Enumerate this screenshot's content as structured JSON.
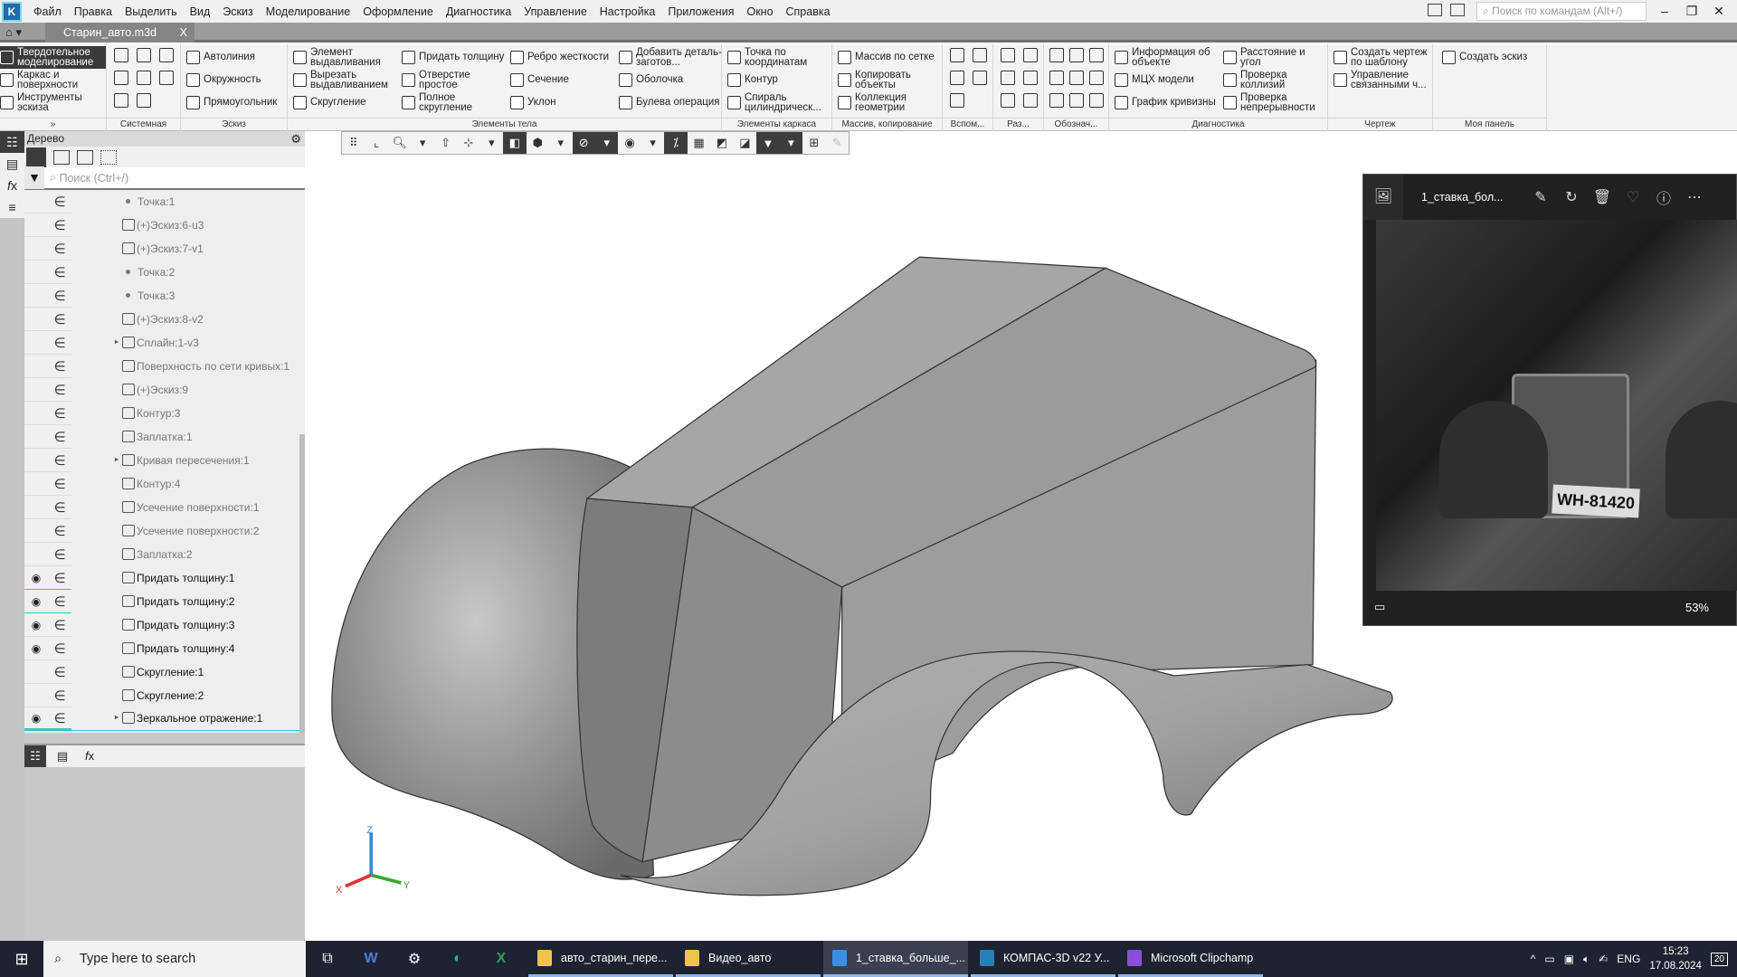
{
  "menubar": {
    "items": [
      "Файл",
      "Правка",
      "Выделить",
      "Вид",
      "Эскиз",
      "Моделирование",
      "Оформление",
      "Диагностика",
      "Управление",
      "Настройка",
      "Приложения",
      "Окно",
      "Справка"
    ],
    "search_placeholder": "Поиск по командам (Alt+/)"
  },
  "tab": {
    "title": "Старин_авто.m3d",
    "close": "X"
  },
  "ribbon": {
    "modes": [
      "Твердотельное моделирование",
      "Каркас и поверхности",
      "Инструменты эскиза"
    ],
    "modes_label": "»",
    "system_label": "Системная",
    "sketch": {
      "label": "Эскиз",
      "items": [
        "Автолиния",
        "Окружность",
        "Прямоугольник"
      ]
    },
    "body": {
      "label": "Элементы тела",
      "columns": [
        [
          "Элемент выдавливания",
          "Вырезать выдавливанием",
          "Скругление"
        ],
        [
          "Придать толщину",
          "Отверстие простое",
          "Полное скругление"
        ],
        [
          "Ребро жесткости",
          "Сечение",
          "Уклон"
        ],
        [
          "Добавить деталь-заготов...",
          "Оболочка",
          "Булева операция"
        ]
      ]
    },
    "wire": {
      "label": "Элементы каркаса",
      "items": [
        "Точка по координатам",
        "Контур",
        "Спираль цилиндрическ..."
      ]
    },
    "array": {
      "label": "Массив, копирование",
      "items": [
        "Массив по сетке",
        "Копировать объекты",
        "Коллекция геометрии"
      ]
    },
    "aux_label": "Вспом...",
    "sec_label": "Раз...",
    "mark_label": "Обознач...",
    "diag": {
      "label": "Диагностика",
      "columns": [
        [
          "Информация об объекте",
          "МЦХ модели",
          "График кривизны"
        ],
        [
          "Расстояние и угол",
          "Проверка коллизий",
          "Проверка непрерывности"
        ]
      ]
    },
    "drawing": {
      "label": "Чертеж",
      "items": [
        "Создать чертеж по шаблону",
        "Управление связанными ч..."
      ]
    },
    "mypanel": {
      "label": "Моя панель",
      "items": [
        "Создать эскиз"
      ]
    }
  },
  "tree": {
    "title": "Дерево",
    "search_placeholder": "Поиск (Ctrl+/)",
    "rows": [
      {
        "label": "Точка:1",
        "icon": "point",
        "visible": false
      },
      {
        "label": "(+)Эскиз:6-u3",
        "icon": "sketch",
        "visible": false
      },
      {
        "label": "(+)Эскиз:7-v1",
        "icon": "sketch",
        "visible": false
      },
      {
        "label": "Точка:2",
        "icon": "point",
        "visible": false
      },
      {
        "label": "Точка:3",
        "icon": "point",
        "visible": false
      },
      {
        "label": "(+)Эскиз:8-v2",
        "icon": "sketch",
        "visible": false
      },
      {
        "label": "Сплайн:1-v3",
        "icon": "spline",
        "visible": false,
        "expandable": true
      },
      {
        "label": "Поверхность по сети кривых:1",
        "icon": "surface",
        "visible": false
      },
      {
        "label": "(+)Эскиз:9",
        "icon": "sketch",
        "visible": false
      },
      {
        "label": "Контур:3",
        "icon": "contour",
        "visible": false
      },
      {
        "label": "Заплатка:1",
        "icon": "patch",
        "visible": false
      },
      {
        "label": "Кривая пересечения:1",
        "icon": "curve",
        "visible": false,
        "expandable": true
      },
      {
        "label": "Контур:4",
        "icon": "contour",
        "visible": false
      },
      {
        "label": "Усечение поверхности:1",
        "icon": "trim",
        "visible": false
      },
      {
        "label": "Усечение поверхности:2",
        "icon": "trim",
        "visible": false
      },
      {
        "label": "Заплатка:2",
        "icon": "patch",
        "visible": false
      },
      {
        "label": "Придать толщину:1",
        "icon": "thicken",
        "visible": true,
        "highlight": true
      },
      {
        "label": "Придать толщину:2",
        "icon": "thicken",
        "visible": true,
        "highlight": true
      },
      {
        "label": "Придать толщину:3",
        "icon": "thicken",
        "visible": true
      },
      {
        "label": "Придать толщину:4",
        "icon": "thicken",
        "visible": true
      },
      {
        "label": "Скругление:1",
        "icon": "fillet",
        "visible": false,
        "dark": true
      },
      {
        "label": "Скругление:2",
        "icon": "fillet",
        "visible": false,
        "dark": true
      },
      {
        "label": "Зеркальное отражение:1",
        "icon": "mirror",
        "visible": true,
        "expandable": true,
        "selected": true
      }
    ]
  },
  "triad": {
    "x": "X",
    "y": "Y",
    "z": "Z"
  },
  "viewer": {
    "title": "1_ставка_бол...",
    "zoom": "53%",
    "plate": "WH-81420"
  },
  "taskbar": {
    "search_placeholder": "Type here to search",
    "apps": [
      {
        "label": "авто_старин_пере...",
        "color": "#f2c14e",
        "active": false
      },
      {
        "label": "Видео_авто",
        "color": "#f2c14e",
        "active": false
      },
      {
        "label": "1_ставка_больше_...",
        "color": "#3b8fe0",
        "active": true
      },
      {
        "label": "КОМПАС-3D v22 У...",
        "color": "#2a7fb8",
        "active": false
      },
      {
        "label": "Microsoft Clipchamp",
        "color": "#8a4fd8",
        "active": false
      }
    ],
    "lang": "ENG",
    "time": "15:23",
    "date": "17.08.2024",
    "notifications": "20"
  },
  "colors": {
    "accent": "#3fc0c8",
    "model": "#9a9a9a",
    "taskbar": "#1d2330"
  }
}
